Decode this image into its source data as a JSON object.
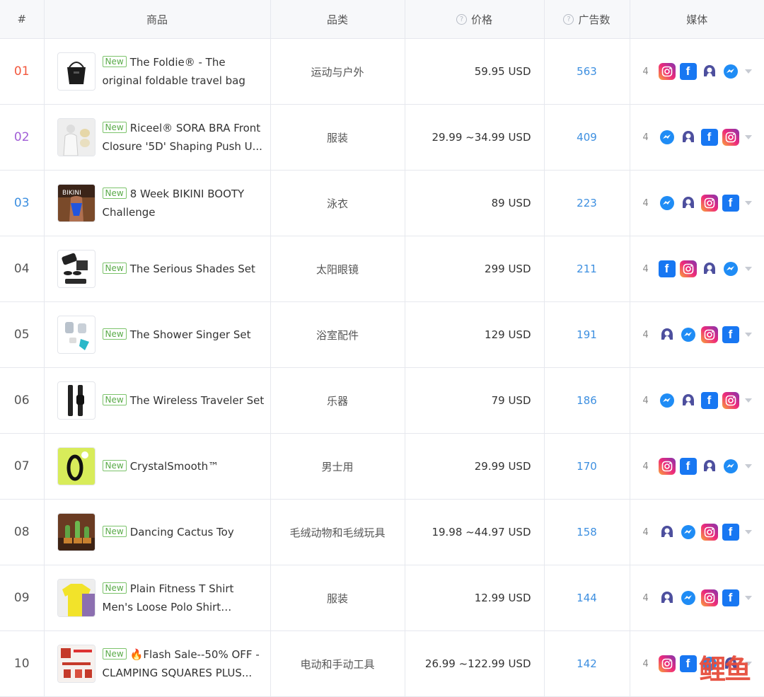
{
  "header": {
    "col_num": "#",
    "col_product": "商品",
    "col_category": "品类",
    "col_price": "价格",
    "col_ads": "广告数",
    "col_media": "媒体",
    "hint_icon": "?"
  },
  "new_badge": "New",
  "rows": [
    {
      "rank": "01",
      "rank_color": "#f2583e",
      "title": "The Foldie® - The original foldable travel bag",
      "category": "运动与户外",
      "price": "59.95 USD",
      "ads": "563",
      "media_count": "4",
      "media": [
        "instagram",
        "facebook",
        "audience",
        "messenger"
      ],
      "thumb": "bag"
    },
    {
      "rank": "02",
      "rank_color": "#a15ed6",
      "title": "Riceel® SORA BRA Front Closure '5D' Shaping Push U...",
      "category": "服装",
      "price": "29.99 ~34.99 USD",
      "ads": "409",
      "media_count": "4",
      "media": [
        "messenger",
        "audience",
        "facebook",
        "instagram"
      ],
      "thumb": "bra"
    },
    {
      "rank": "03",
      "rank_color": "#3d8fe0",
      "title": "8 Week BIKINI BOOTY Challenge",
      "category": "泳衣",
      "price": "89 USD",
      "ads": "223",
      "media_count": "4",
      "media": [
        "messenger",
        "audience",
        "instagram",
        "facebook"
      ],
      "thumb": "bikini"
    },
    {
      "rank": "04",
      "rank_color": "#555555",
      "title": "The Serious Shades Set",
      "category": "太阳眼镜",
      "price": "299 USD",
      "ads": "211",
      "media_count": "4",
      "media": [
        "facebook",
        "instagram",
        "audience",
        "messenger"
      ],
      "thumb": "shades"
    },
    {
      "rank": "05",
      "rank_color": "#555555",
      "title": "The Shower Singer Set",
      "category": "浴室配件",
      "price": "129 USD",
      "ads": "191",
      "media_count": "4",
      "media": [
        "audience",
        "messenger",
        "instagram",
        "facebook"
      ],
      "thumb": "shower"
    },
    {
      "rank": "06",
      "rank_color": "#555555",
      "title": "The Wireless Traveler Set",
      "category": "乐器",
      "price": "79 USD",
      "ads": "186",
      "media_count": "4",
      "media": [
        "messenger",
        "audience",
        "facebook",
        "instagram"
      ],
      "thumb": "watch"
    },
    {
      "rank": "07",
      "rank_color": "#555555",
      "title": "CrystalSmooth™",
      "category": "男士用",
      "price": "29.99 USD",
      "ads": "170",
      "media_count": "4",
      "media": [
        "instagram",
        "facebook",
        "audience",
        "messenger"
      ],
      "thumb": "crystal"
    },
    {
      "rank": "08",
      "rank_color": "#555555",
      "title": "Dancing Cactus Toy",
      "category": "毛绒动物和毛绒玩具",
      "price": "19.98 ~44.97 USD",
      "ads": "158",
      "media_count": "4",
      "media": [
        "audience",
        "messenger",
        "instagram",
        "facebook"
      ],
      "thumb": "cactus"
    },
    {
      "rank": "09",
      "rank_color": "#555555",
      "title": "Plain Fitness T Shirt Men's Loose Polo Shirt Father...",
      "category": "服装",
      "price": "12.99 USD",
      "ads": "144",
      "media_count": "4",
      "media": [
        "audience",
        "messenger",
        "instagram",
        "facebook"
      ],
      "thumb": "shirt"
    },
    {
      "rank": "10",
      "rank_color": "#555555",
      "title": "🔥Flash Sale--50% OFF - CLAMPING SQUARES PLUS...",
      "category": "电动和手动工具",
      "price": "26.99 ~122.99 USD",
      "ads": "142",
      "media_count": "4",
      "media": [
        "instagram",
        "facebook",
        "messenger",
        "audience"
      ],
      "thumb": "clamp"
    }
  ],
  "watermark": "鲤鱼"
}
